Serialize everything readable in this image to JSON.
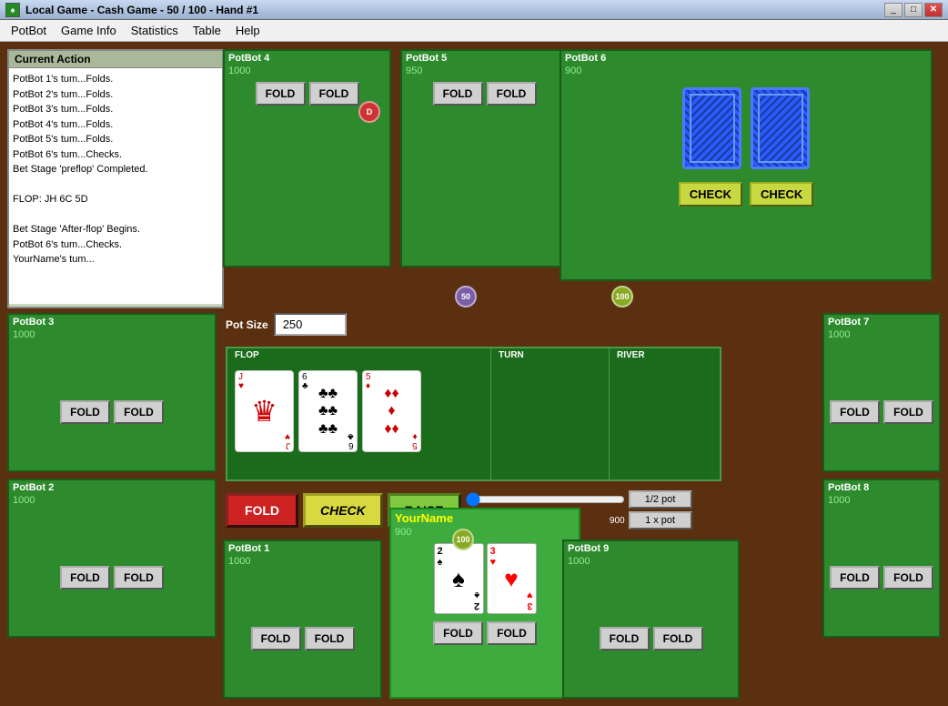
{
  "window": {
    "title": "Local Game - Cash Game - 50 / 100 - Hand #1",
    "icon": "♠"
  },
  "menu": {
    "items": [
      "PotBot",
      "Game Info",
      "Statistics",
      "Table",
      "Help"
    ]
  },
  "currentAction": {
    "title": "Current Action",
    "log": [
      "PotBot 1's tum...Folds.",
      "PotBot 2's tum...Folds.",
      "PotBot 3's tum...Folds.",
      "PotBot 4's tum...Folds.",
      "PotBot 5's tum...Folds.",
      "PotBot 6's tum...Checks.",
      "Bet Stage 'preflop' Completed.",
      "",
      "FLOP: JH 6C 5D",
      "",
      "Bet Stage 'After-flop' Begins.",
      "PotBot 6's tum...Checks.",
      "YourName's tum..."
    ]
  },
  "potSize": {
    "label": "Pot Size",
    "value": "250"
  },
  "players": {
    "potbot4": {
      "name": "PotBot 4",
      "chips": "1000"
    },
    "potbot5": {
      "name": "PotBot 5",
      "chips": "950"
    },
    "potbot6": {
      "name": "PotBot 6",
      "chips": "900"
    },
    "potbot3": {
      "name": "PotBot 3",
      "chips": "1000"
    },
    "potbot2": {
      "name": "PotBot 2",
      "chips": "1000"
    },
    "potbot7": {
      "name": "PotBot 7",
      "chips": "1000"
    },
    "potbot8": {
      "name": "PotBot 8",
      "chips": "1000"
    },
    "potbot1": {
      "name": "PotBot 1",
      "chips": "1000"
    },
    "yourname": {
      "name": "YourName",
      "chips": "900"
    },
    "potbot9": {
      "name": "PotBot 9",
      "chips": "1000"
    }
  },
  "tokens": {
    "dealer": "D",
    "small_blind": "50",
    "big_blind": "100"
  },
  "buttons": {
    "fold": "FOLD",
    "check": "CHECK",
    "raise": "RAISE",
    "half_pot": "1/2 pot",
    "one_pot": "1 x pot"
  },
  "flop": {
    "cards": [
      {
        "rank": "J",
        "suit": "H",
        "color": "red",
        "symbol": "♥",
        "display": "JH"
      },
      {
        "rank": "6",
        "suit": "C",
        "color": "black",
        "symbol": "♣",
        "display": "6C"
      },
      {
        "rank": "5",
        "suit": "D",
        "color": "red",
        "symbol": "♦",
        "display": "5D"
      }
    ]
  },
  "playerCards": {
    "rank1": "2",
    "suit1": "♠",
    "color1": "black",
    "rank2": "3",
    "suit2": "♥",
    "color2": "red"
  },
  "betSlider": {
    "min": "100",
    "max": "900",
    "value": "100"
  }
}
